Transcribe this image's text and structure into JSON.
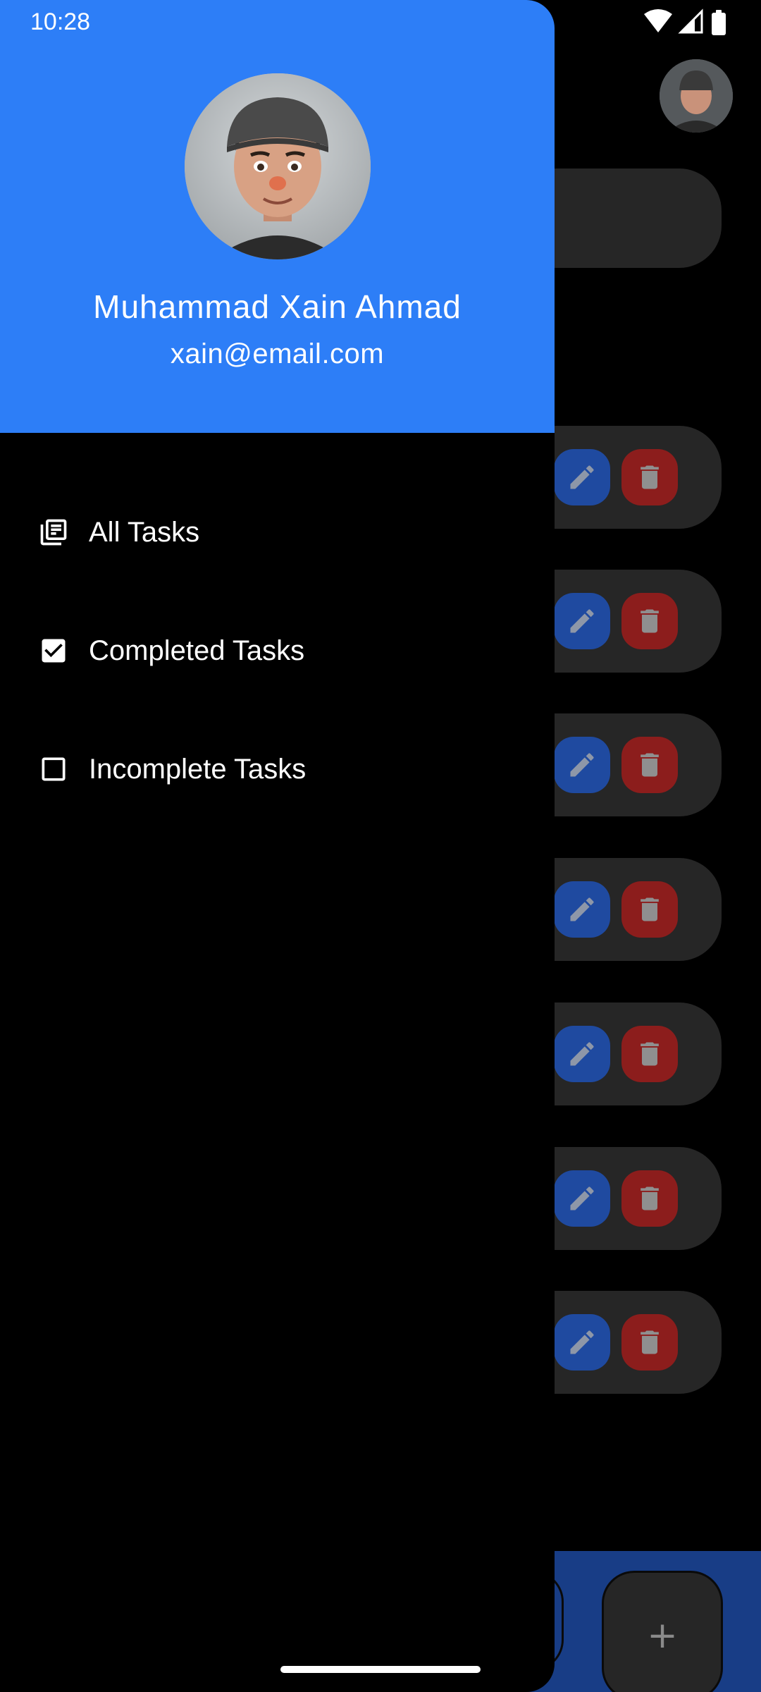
{
  "status_bar": {
    "time": "10:28"
  },
  "drawer": {
    "user": {
      "name": "Muhammad Xain Ahmad",
      "email": "xain@email.com"
    },
    "menu": [
      {
        "label": "All Tasks",
        "icon": "library-books-icon"
      },
      {
        "label": "Completed Tasks",
        "icon": "checkbox-checked-icon"
      },
      {
        "label": "Incomplete Tasks",
        "icon": "checkbox-unchecked-icon"
      }
    ]
  },
  "background": {
    "fab_label": "+",
    "task_count": 7
  },
  "colors": {
    "drawer_header": "#2d7ef7",
    "edit_button": "#1f4aa0",
    "delete_button": "#8c1d1c",
    "card": "#262626"
  }
}
